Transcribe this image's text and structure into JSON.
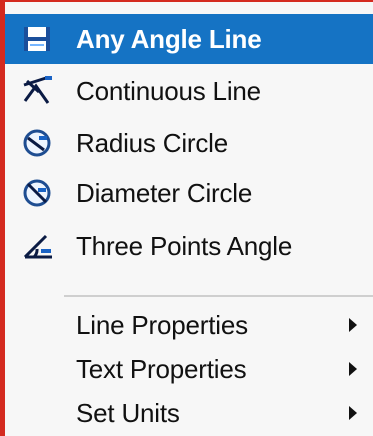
{
  "menu": {
    "items": [
      {
        "label": "Any Angle Line",
        "icon": "any-angle-line-icon",
        "selected": true
      },
      {
        "label": "Continuous Line",
        "icon": "continuous-line-icon",
        "selected": false
      },
      {
        "label": "Radius Circle",
        "icon": "radius-circle-icon",
        "selected": false
      },
      {
        "label": "Diameter Circle",
        "icon": "diameter-circle-icon",
        "selected": false
      },
      {
        "label": "Three Points Angle",
        "icon": "three-points-angle-icon",
        "selected": false
      }
    ],
    "submenus": [
      {
        "label": "Line Properties",
        "icon": "chevron-right-icon"
      },
      {
        "label": "Text Properties",
        "icon": "chevron-right-icon"
      },
      {
        "label": "Set Units",
        "icon": "chevron-right-icon"
      }
    ]
  },
  "colors": {
    "selection": "#1573c4",
    "accent_edge": "#d42a1f",
    "menu_background": "#f7f7f7",
    "separator": "#cfcfcf"
  }
}
